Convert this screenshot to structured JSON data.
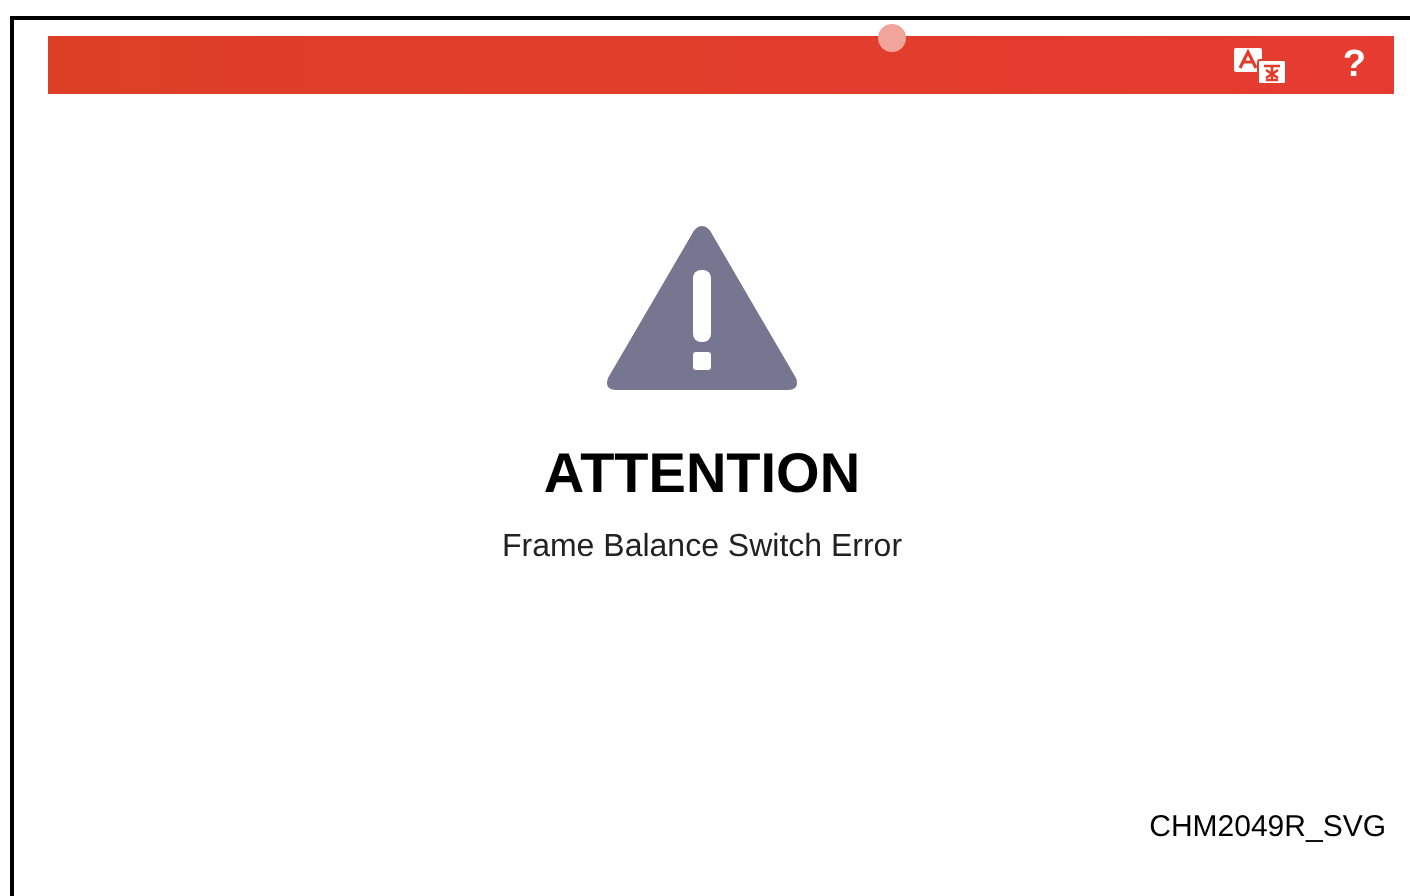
{
  "top_bar": {
    "help": "?"
  },
  "alert": {
    "title": "ATTENTION",
    "message": "Frame Balance Switch Error"
  },
  "figure_label": "CHM2049R_SVG"
}
